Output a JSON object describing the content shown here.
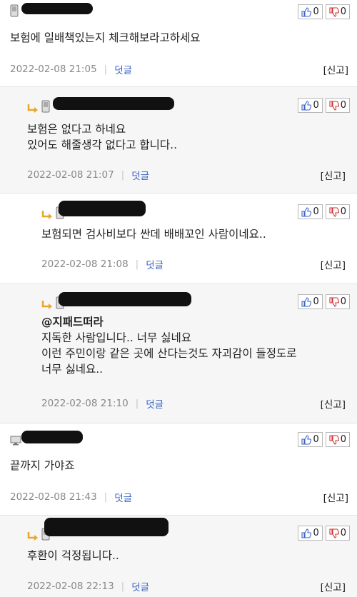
{
  "comments": [
    {
      "body": [
        "보험에 일배책있는지 체크해보라고하세요"
      ],
      "date": "2022-02-08 21:05",
      "reply_label": "덧글",
      "report_label": "[신고]",
      "likes": "0",
      "dislikes": "0",
      "device_icon": "phone-icon"
    },
    {
      "body": [
        "보험은 없다고 하네요",
        "있어도 해줄생각 없다고 합니다.."
      ],
      "date": "2022-02-08 21:07",
      "reply_label": "덧글",
      "report_label": "[신고]",
      "likes": "0",
      "dislikes": "0",
      "device_icon": "phone-icon"
    },
    {
      "body": [
        "보험되면 검사비보다 싼데 배배꼬인 사람이네요.."
      ],
      "date": "2022-02-08 21:08",
      "reply_label": "덧글",
      "report_label": "[신고]",
      "likes": "0",
      "dislikes": "0",
      "device_icon": "phone-icon"
    },
    {
      "mention": "@지패드떠라",
      "body": [
        "지독한 사람입니다.. 너무 싫네요",
        "이런 주민이랑 같은 곳에 산다는것도 자괴감이 들정도로",
        "너무 싫네요.."
      ],
      "date": "2022-02-08 21:10",
      "reply_label": "덧글",
      "report_label": "[신고]",
      "likes": "0",
      "dislikes": "0",
      "device_icon": "phone-icon"
    },
    {
      "body": [
        "끝까지 가야죠"
      ],
      "date": "2022-02-08 21:43",
      "reply_label": "덧글",
      "report_label": "[신고]",
      "likes": "0",
      "dislikes": "0",
      "device_icon": "monitor-icon"
    },
    {
      "body": [
        "후환이 걱정됩니다.."
      ],
      "date": "2022-02-08 22:13",
      "reply_label": "덧글",
      "report_label": "[신고]",
      "likes": "0",
      "dislikes": "0",
      "device_icon": "phone-icon"
    }
  ]
}
